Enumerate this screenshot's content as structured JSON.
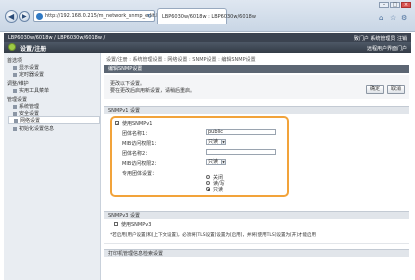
{
  "browser": {
    "url": "http://192.168.0.215/m_network_snmp_edit.html",
    "tab_title": "LBP6030w/6018w : LBP6030w/6018w",
    "nav_back_icon": "back-arrow-icon",
    "nav_forward_icon": "forward-arrow-icon"
  },
  "rui": {
    "device": "LBP6030w/6018w / LBP6030w/6018w / ",
    "top_links": "致门户  系统管理员  注销",
    "title": "设置/注册",
    "portal": "远程用户界面门户"
  },
  "sidebar": {
    "groups": [
      {
        "label": "首选项",
        "items": [
          "显示设置",
          "定时器设置"
        ]
      },
      {
        "label": "调整/维护",
        "items": [
          "实用工具菜单"
        ]
      },
      {
        "label": "管理设置",
        "items": [
          "系统管理",
          "安全设置",
          "网络设置",
          "初始化设置信息"
        ]
      }
    ],
    "active": "网络设置"
  },
  "main": {
    "breadcrumb": "设置/注册 : 系统管理设置 : 网络设置 : SNMP设置 : 编辑SNMP设置",
    "section_title": "编辑SNMP设置",
    "confirm_line1": "更改以下设置。",
    "confirm_line2": "要在更改后启用新设置，请稍后重启。",
    "ok_label": "确定",
    "cancel_label": "取消",
    "v1_header": "SNMPv1 设置",
    "use_v1": "使用SNMPv1",
    "community1_label": "团体名称1：",
    "community1_value": "public",
    "mib1_label": "MIB访问权限1：",
    "mib1_value": "只读",
    "community2_label": "团体名称2：",
    "community2_value": "",
    "mib2_label": "MIB访问权限2：",
    "mib2_value": "只读",
    "dedicated_label": "专用团体设置：",
    "dedicated_options": [
      "关闭",
      "读/写",
      "只读"
    ],
    "v3_header": "SNMPv3 设置",
    "use_v3": "使用SNMPv3",
    "v3_note": "*若启用[用户设置]和[上下文设置]，必须将[TLS设置]设置为[启用]，并将[使用TLS]设置为[开]才能启用",
    "next_header": "打印机管理信息检索设置"
  },
  "colors": {
    "accent_orange": "#f2a33a",
    "header_dark": "#3b4350",
    "section_bar": "#5c6673"
  }
}
